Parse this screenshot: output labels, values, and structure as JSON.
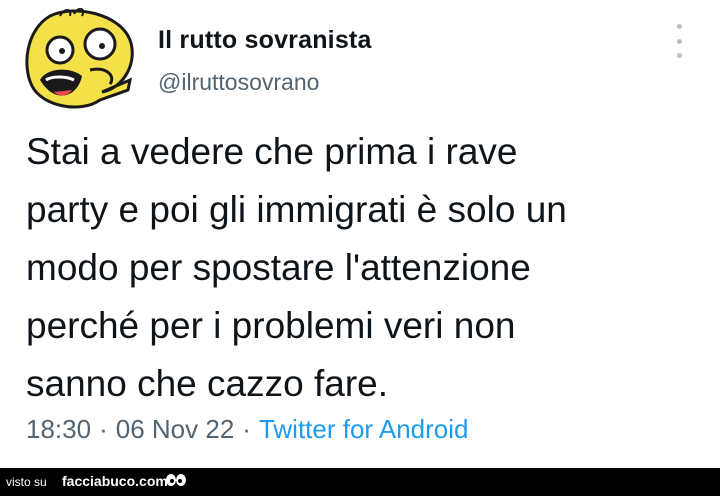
{
  "tweet": {
    "display_name": "Il rutto sovranista",
    "handle": "@ilruttosovrano",
    "text_lines": [
      "Stai a vedere che prima i rave",
      "party e poi gli immigrati è solo un",
      "modo per spostare l'attenzione",
      "perché per i problemi veri non",
      "sanno che cazzo fare."
    ],
    "time": "18:30",
    "separator": "·",
    "date": "06 Nov 22",
    "source": "Twitter for Android"
  },
  "footer": {
    "visto_su": "visto su",
    "site": "facciabuco.com"
  },
  "icons": {
    "avatar": "cartoon-face-avatar",
    "more": "vertical-ellipsis-icon",
    "logo": "eyes-logo-icon"
  }
}
